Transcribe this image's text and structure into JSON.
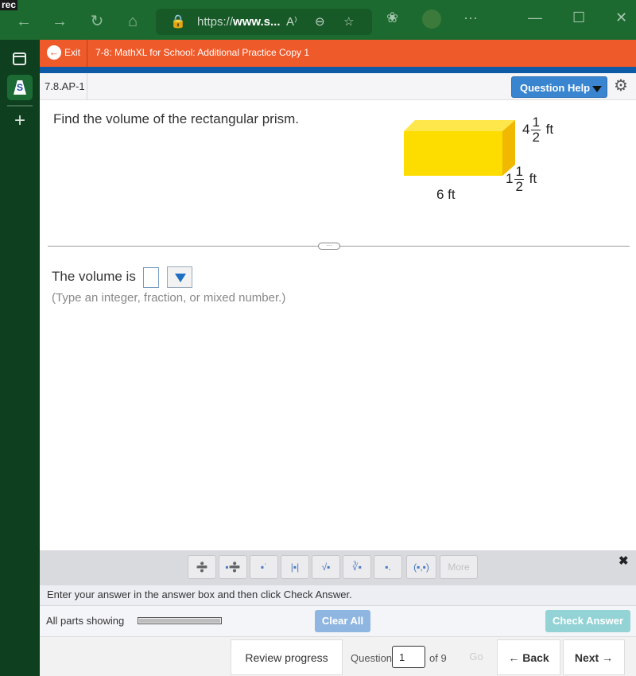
{
  "browser": {
    "recording_label": "rec",
    "url_prefix": "https://",
    "url_domain": "www.s...",
    "read_aloud_icon": "A⁾",
    "more_label": "···"
  },
  "header": {
    "exit_label": "Exit",
    "course_title": "7-8: MathXL for School: Additional Practice Copy 1",
    "question_id": "7.8.AP-1",
    "question_help_label": "Question Help"
  },
  "question": {
    "prompt": "Find the volume of the rectangular prism.",
    "figure": {
      "fill_color": "#fde000",
      "length_label": "6 ft",
      "height": {
        "whole": "4",
        "num": "1",
        "den": "2",
        "unit": "ft"
      },
      "width": {
        "whole": "1",
        "num": "1",
        "den": "2",
        "unit": "ft"
      }
    },
    "answer_prefix": "The volume is",
    "answer_value": "",
    "unit_dropdown_value": "",
    "hint": "(Type an integer, fraction, or mixed number.)"
  },
  "math_toolbar": {
    "buttons": [
      {
        "name": "fraction",
        "glyph": "➗"
      },
      {
        "name": "mixed-number",
        "glyph": "▪➗"
      },
      {
        "name": "exponent",
        "glyph": "▪˙"
      },
      {
        "name": "absolute-value",
        "glyph": "|▪|"
      },
      {
        "name": "square-root",
        "glyph": "√▪"
      },
      {
        "name": "nth-root",
        "glyph": "∛▪"
      },
      {
        "name": "subscript",
        "glyph": "▪."
      },
      {
        "name": "ordered-pair",
        "glyph": "(▪,▪)"
      },
      {
        "name": "more",
        "glyph": "More"
      }
    ],
    "close_glyph": "✖"
  },
  "instructions": "Enter your answer in the answer box and then click Check Answer.",
  "parts": {
    "label": "All parts showing",
    "clear_all_label": "Clear All",
    "check_answer_label": "Check Answer"
  },
  "footer": {
    "review_progress_label": "Review progress",
    "question_label": "Question",
    "question_number": "1",
    "of_label": "of 9",
    "go_label": "Go",
    "back_label": "← Back",
    "next_label": "Next →"
  }
}
